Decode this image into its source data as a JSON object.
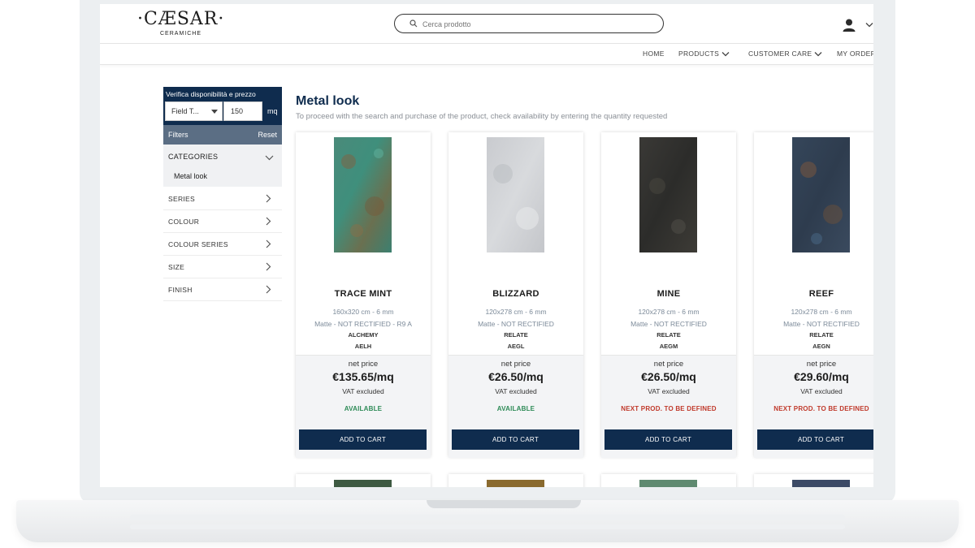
{
  "header": {
    "logo_text": "·CÆSAR·",
    "logo_sub": "CERAMICHE",
    "search_placeholder": "Cerca prodotto"
  },
  "nav": {
    "items": [
      {
        "label": "HOME"
      },
      {
        "label": "PRODUCTS"
      },
      {
        "label": "CUSTOMER CARE"
      },
      {
        "label": "MY ORDER"
      }
    ]
  },
  "sidebar": {
    "availability_title": "Verifica disponibilità e prezzo",
    "select_value": "Field T...",
    "quantity_value": "150",
    "unit": "mq",
    "filters_label": "Filters",
    "reset_label": "Reset",
    "categories_label": "CATEGORIES",
    "selected_category": "Metal look",
    "facets": [
      "SERIES",
      "COLOUR",
      "COLOUR SERIES",
      "SIZE",
      "FINISH"
    ]
  },
  "main": {
    "title": "Metal look",
    "subtitle": "To proceed with the search and purchase of the product, check availability by entering the quantity requested"
  },
  "products": [
    {
      "name": "TRACE MINT",
      "size": "160x320 cm - 6 mm",
      "finish": "Matte -  NOT RECTIFIED - R9 A",
      "series": "ALCHEMY",
      "code": "AELH",
      "net_label": "net price",
      "price": "€135.65/mq",
      "vat": "VAT excluded",
      "status": "AVAILABLE",
      "status_color": "#2e8b57",
      "button": "ADD TO CART"
    },
    {
      "name": "BLIZZARD",
      "size": "120x278 cm - 6 mm",
      "finish": "Matte -  NOT RECTIFIED",
      "series": "RELATE",
      "code": "AEGL",
      "net_label": "net price",
      "price": "€26.50/mq",
      "vat": "VAT excluded",
      "status": "AVAILABLE",
      "status_color": "#2e8b57",
      "button": "ADD TO CART"
    },
    {
      "name": "MINE",
      "size": "120x278 cm - 6 mm",
      "finish": "Matte -  NOT RECTIFIED",
      "series": "RELATE",
      "code": "AEGM",
      "net_label": "net price",
      "price": "€26.50/mq",
      "vat": "VAT excluded",
      "status": "NEXT PROD. TO BE DEFINED",
      "status_color": "#c0392b",
      "button": "ADD TO CART"
    },
    {
      "name": "REEF",
      "size": "120x278 cm - 6 mm",
      "finish": "Matte -  NOT RECTIFIED",
      "series": "RELATE",
      "code": "AEGN",
      "net_label": "net price",
      "price": "€29.60/mq",
      "vat": "VAT excluded",
      "status": "NEXT PROD. TO BE DEFINED",
      "status_color": "#c0392b",
      "button": "ADD TO CART"
    }
  ],
  "colors": {
    "brand_navy": "#0f2c4e",
    "available_green": "#2e8b57",
    "undefined_red": "#c0392b"
  }
}
